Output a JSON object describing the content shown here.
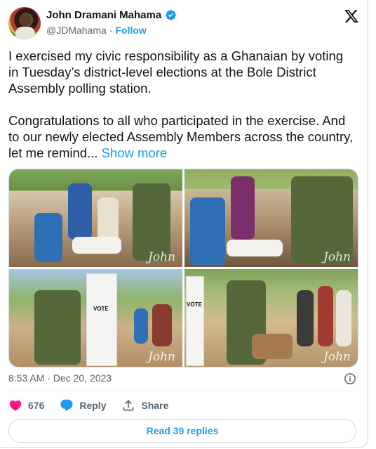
{
  "author": {
    "name": "John Dramani Mahama",
    "handle": "@JDMahama",
    "separator": "·",
    "follow_label": "Follow"
  },
  "tweet": {
    "paragraph_1": "I exercised my civic responsibility as a Ghanaian by voting in Tuesday’s district-level elections at the Bole District Assembly polling station.",
    "paragraph_2": "Congratulations to all who participated in the exercise. And to our newly elected Assembly Members across the country, let me remind...",
    "show_more": "Show more"
  },
  "media": {
    "photos": [
      {
        "watermark": "John"
      },
      {
        "watermark": "John"
      },
      {
        "watermark": "John",
        "ballot_box_label": "VOTE"
      },
      {
        "watermark": "John",
        "ballot_box_label": "VOTE"
      }
    ]
  },
  "meta": {
    "timestamp": "8:53 AM · Dec 20, 2023"
  },
  "actions": {
    "like_count": "676",
    "reply_label": "Reply",
    "share_label": "Share"
  },
  "replies": {
    "label": "Read 39 replies"
  },
  "colors": {
    "accent": "#1d9bf0",
    "like": "#f91880",
    "text_secondary": "#536471"
  },
  "icons": [
    "verified-badge-icon",
    "x-logo-icon",
    "info-icon",
    "heart-icon",
    "reply-bubble-icon",
    "share-icon"
  ]
}
